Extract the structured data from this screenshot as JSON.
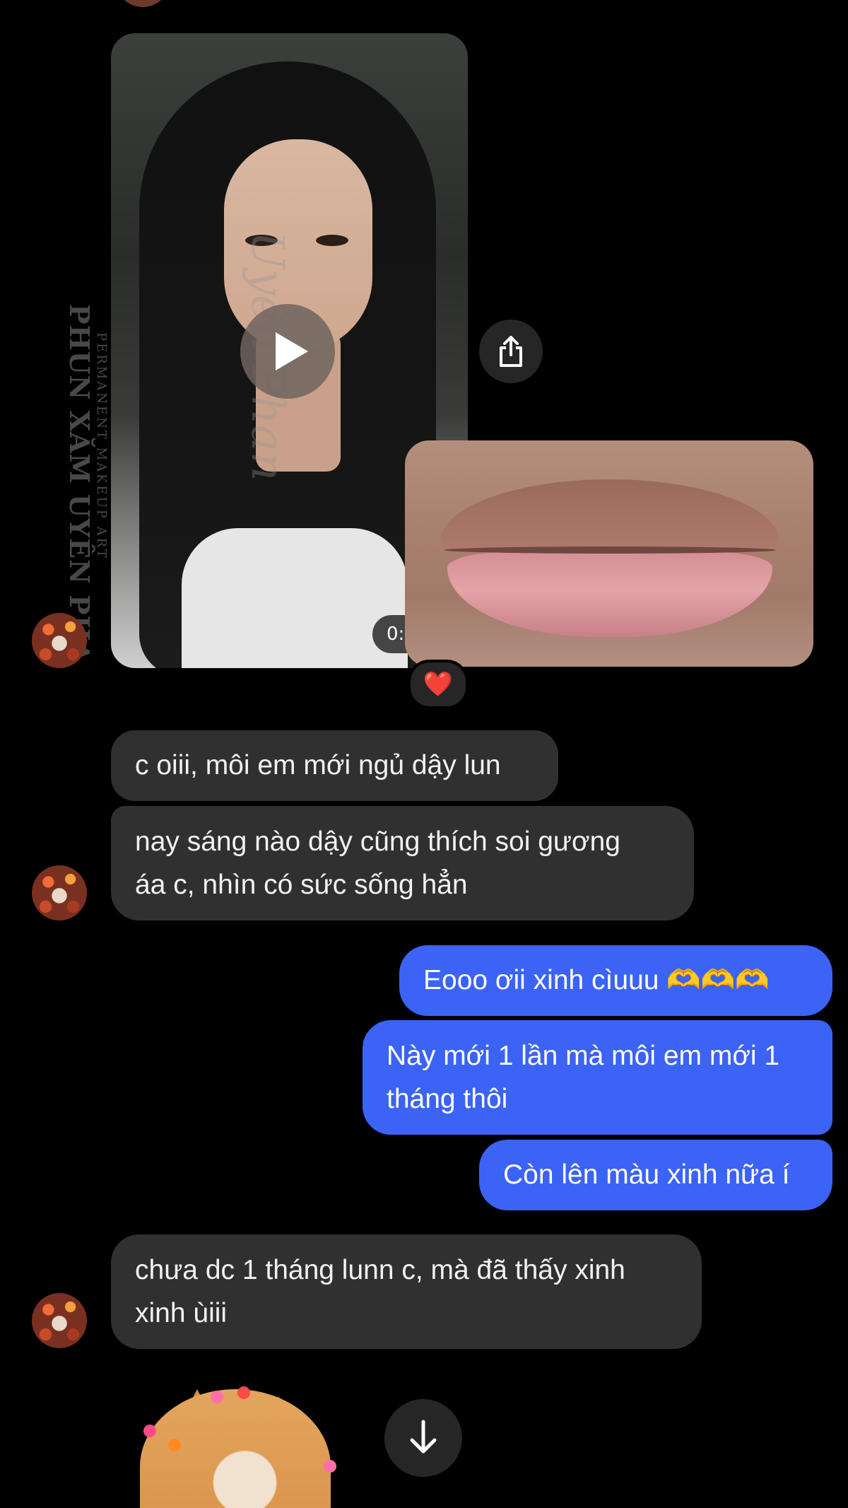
{
  "colors": {
    "background": "#000000",
    "incoming_bubble": "#303030",
    "outgoing_bubble": "#3b63f5",
    "text": "#f2f2f2",
    "reaction_heart": "#ff2d3a"
  },
  "media": {
    "video": {
      "duration_label": "0:",
      "watermark_brand": "PHUN XĂM UYÊN PHA",
      "watermark_tagline": "PERMANENT MAKEUP ART",
      "watermark_signature": "Uyên Phan"
    },
    "reaction_emoji": "❤️"
  },
  "messages": [
    {
      "direction": "incoming",
      "text": "c oiii, môi em mới ngủ dậy lun"
    },
    {
      "direction": "incoming",
      "text": "nay sáng nào dậy cũng thích soi gương\náa c, nhìn có sức sống hẳn"
    },
    {
      "direction": "outgoing",
      "text": "Eooo ơii xinh cìuuu 🫶🫶🫶"
    },
    {
      "direction": "outgoing",
      "text": "Này mới 1 lần mà môi em mới 1\ntháng thôi"
    },
    {
      "direction": "outgoing",
      "text": "Còn lên màu xinh nữa í"
    },
    {
      "direction": "incoming",
      "text": "chưa dc 1 tháng lunn c, mà đã thấy xinh\nxinh ùiii"
    }
  ],
  "icons": {
    "share": "share-icon",
    "play": "play-icon",
    "scroll_down": "arrow-down-icon"
  }
}
